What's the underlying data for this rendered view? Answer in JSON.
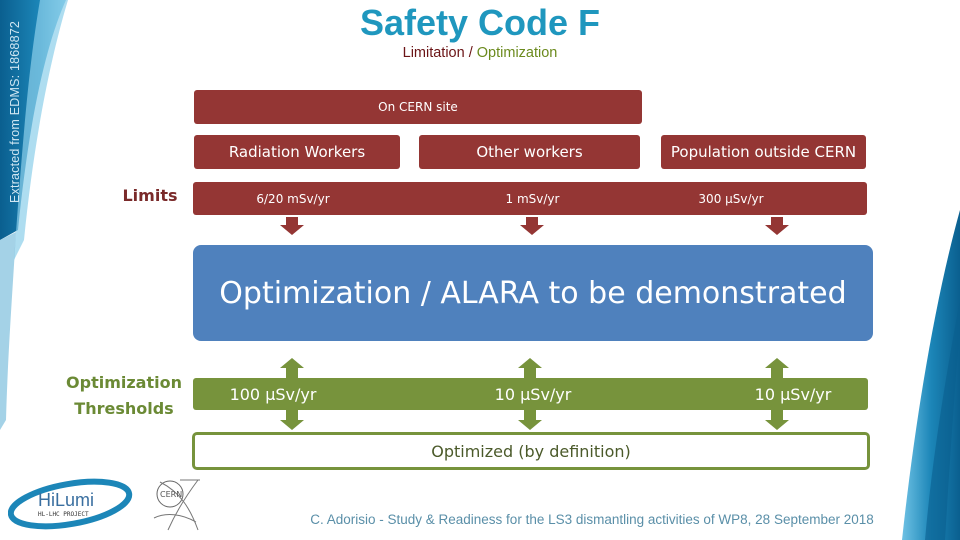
{
  "slide": {
    "side_watermark": "Extracted from EDMS: 1868872",
    "title": "Safety Code F",
    "subtitle": {
      "limitation": "Limitation",
      "separator": " / ",
      "optimization": "Optimization"
    },
    "site_header": "On CERN site",
    "categories": [
      {
        "label": "Radiation Workers"
      },
      {
        "label": "Other workers"
      },
      {
        "label": "Population outside CERN"
      }
    ],
    "limits": {
      "label": "Limits",
      "values": [
        "6/20 mSv/yr",
        "1 mSv/yr",
        "300 µSv/yr"
      ]
    },
    "optimization_box": "Optimization / ALARA to be demonstrated",
    "thresholds": {
      "label_line1": "Optimization",
      "label_line2": "Thresholds",
      "values": [
        "100 µSv/yr",
        "10 µSv/yr",
        "10 µSv/yr"
      ]
    },
    "optimized_note": "Optimized (by definition)",
    "footer": "C. Adorisio - Study & Readiness for the LS3 dismantling activities of WP8, 28 September 2018",
    "logos": {
      "hilumi_main": "HiLumi",
      "hilumi_sub": "HL-LHC PROJECT",
      "cern": "CERN"
    }
  },
  "colors": {
    "title": "#1f97be",
    "limitation": "#943634",
    "optimization_blue": "#4f81bd",
    "threshold_green": "#77933c"
  }
}
